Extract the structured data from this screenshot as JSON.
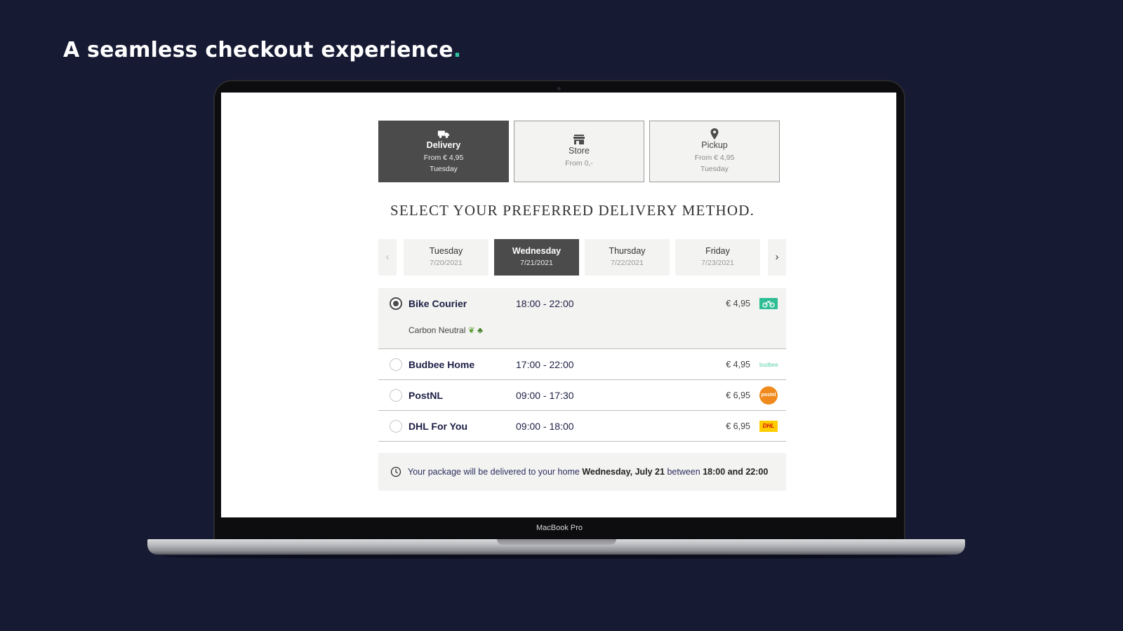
{
  "headline": {
    "text": "A seamless checkout experience",
    "dot": ".",
    "dot_color": "#2ec4a0"
  },
  "device": {
    "label": "MacBook Pro"
  },
  "methods": [
    {
      "name": "Delivery",
      "price": "From € 4,95",
      "day": "Tuesday",
      "icon": "truck-icon",
      "active": true
    },
    {
      "name": "Store",
      "price": "From 0,-",
      "day": "",
      "icon": "store-icon",
      "active": false
    },
    {
      "name": "Pickup",
      "price": "From € 4,95",
      "day": "Tuesday",
      "icon": "location-pin-icon",
      "active": false
    }
  ],
  "section_title": "SELECT YOUR PREFERRED DELIVERY METHOD.",
  "days": [
    {
      "name": "Tuesday",
      "date": "7/20/2021",
      "active": false
    },
    {
      "name": "Wednesday",
      "date": "7/21/2021",
      "active": true
    },
    {
      "name": "Thursday",
      "date": "7/22/2021",
      "active": false
    },
    {
      "name": "Friday",
      "date": "7/23/2021",
      "active": false
    }
  ],
  "nav": {
    "prev": "‹",
    "next": "›"
  },
  "options": [
    {
      "name": "Bike Courier",
      "time": "18:00 - 22:00",
      "price": "€ 4,95",
      "selected": true,
      "note": "Carbon Neutral",
      "logo": "bike-courier-logo",
      "logo_color": "#2ebd94"
    },
    {
      "name": "Budbee Home",
      "time": "17:00 - 22:00",
      "price": "€ 4,95",
      "selected": false,
      "logo": "budbee-logo",
      "logo_text": "budbee",
      "logo_color": "#58d3a8"
    },
    {
      "name": "PostNL",
      "time": "09:00 - 17:30",
      "price": "€ 6,95",
      "selected": false,
      "logo": "postnl-logo",
      "logo_text": "postnl",
      "logo_color": "#f08a1c"
    },
    {
      "name": "DHL For You",
      "time": "09:00 - 18:00",
      "price": "€ 6,95",
      "selected": false,
      "logo": "dhl-logo",
      "logo_text": "DHL",
      "logo_color": "#ffcc00"
    }
  ],
  "info": {
    "prefix": "Your package will be delivered to your home",
    "date": "Wednesday, July 21",
    "middle": "between",
    "window": "18:00 and 22:00"
  },
  "colors": {
    "background": "#161a33",
    "active": "#4b4b4b",
    "panel": "#f3f3f1",
    "text_dark_blue": "#1c1e44"
  }
}
